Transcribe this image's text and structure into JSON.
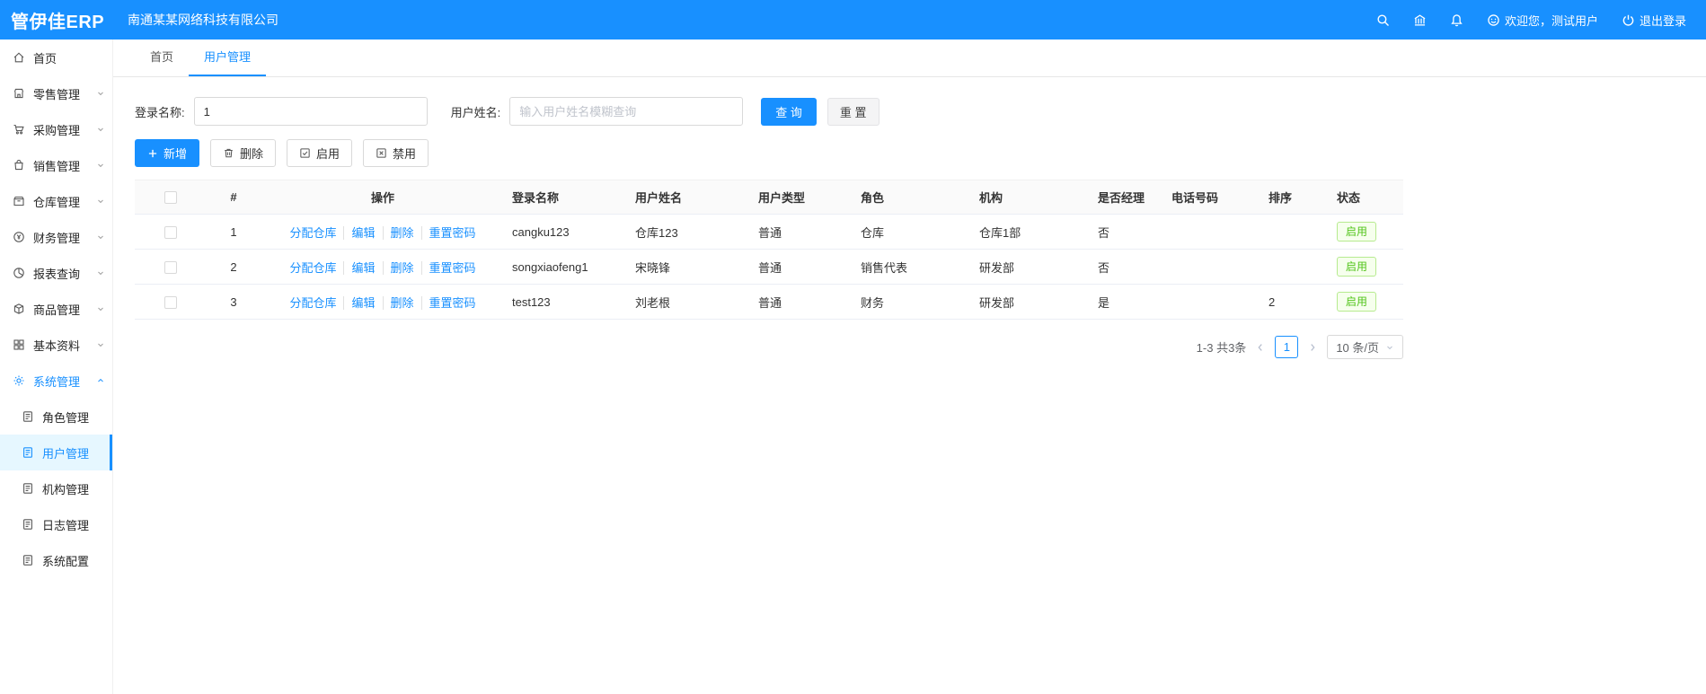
{
  "header": {
    "logo": "管伊佳ERP",
    "company": "南通某某网络科技有限公司",
    "welcome": "欢迎您，测试用户",
    "logout": "退出登录"
  },
  "sidebar": {
    "items": [
      {
        "label": "首页"
      },
      {
        "label": "零售管理"
      },
      {
        "label": "采购管理"
      },
      {
        "label": "销售管理"
      },
      {
        "label": "仓库管理"
      },
      {
        "label": "财务管理"
      },
      {
        "label": "报表查询"
      },
      {
        "label": "商品管理"
      },
      {
        "label": "基本资料"
      },
      {
        "label": "系统管理"
      }
    ],
    "subitems": [
      {
        "label": "角色管理"
      },
      {
        "label": "用户管理"
      },
      {
        "label": "机构管理"
      },
      {
        "label": "日志管理"
      },
      {
        "label": "系统配置"
      }
    ]
  },
  "tabs": [
    {
      "label": "首页"
    },
    {
      "label": "用户管理"
    }
  ],
  "filters": {
    "login_name_label": "登录名称:",
    "login_name_value": "1",
    "user_name_label": "用户姓名:",
    "user_name_placeholder": "输入用户姓名模糊查询",
    "search_button": "查 询",
    "reset_button": "重 置"
  },
  "toolbar": {
    "add": "新增",
    "delete": "删除",
    "enable": "启用",
    "disable": "禁用"
  },
  "table": {
    "columns": [
      "#",
      "操作",
      "登录名称",
      "用户姓名",
      "用户类型",
      "角色",
      "机构",
      "是否经理",
      "电话号码",
      "排序",
      "状态"
    ],
    "action_links": [
      "分配仓库",
      "编辑",
      "删除",
      "重置密码"
    ],
    "rows": [
      {
        "index": "1",
        "login": "cangku123",
        "name": "仓库123",
        "type": "普通",
        "role": "仓库",
        "org": "仓库1部",
        "manager": "否",
        "phone": "",
        "sort": "",
        "status": "启用"
      },
      {
        "index": "2",
        "login": "songxiaofeng1",
        "name": "宋晓锋",
        "type": "普通",
        "role": "销售代表",
        "org": "研发部",
        "manager": "否",
        "phone": "",
        "sort": "",
        "status": "启用"
      },
      {
        "index": "3",
        "login": "test123",
        "name": "刘老根",
        "type": "普通",
        "role": "财务",
        "org": "研发部",
        "manager": "是",
        "phone": "",
        "sort": "2",
        "status": "启用"
      }
    ]
  },
  "pagination": {
    "range_text": "1-3 共3条",
    "current_page": "1",
    "page_size": "10 条/页"
  },
  "icons": {
    "search": "magnifier",
    "bank": "building",
    "bell": "notification",
    "smiley": "user-welcome",
    "power": "logout",
    "plus": "+",
    "trash": "delete",
    "check_square": "enable",
    "x_square": "disable",
    "chevron_down": "v",
    "chevron_up": "^"
  },
  "colors": {
    "primary": "#1890ff",
    "header_bg": "#1890ff",
    "active_item_bg": "#e6f7ff",
    "status_green": "#52c41a",
    "status_green_bg": "#f6ffed",
    "status_green_border": "#b7eb8f"
  }
}
